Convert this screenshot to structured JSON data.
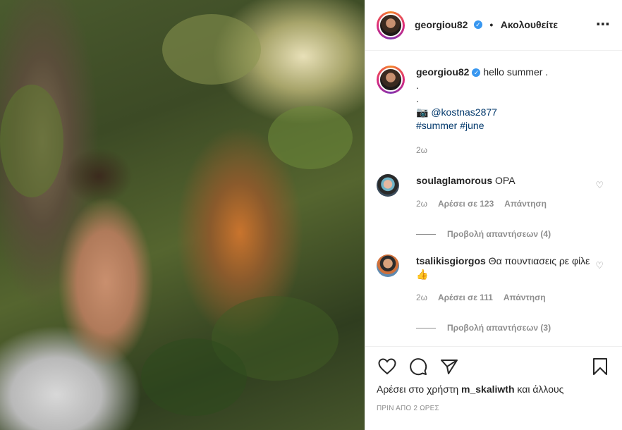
{
  "header": {
    "username": "georgiou82",
    "verified_mark": "✓",
    "separator": "•",
    "follow_label": "Ακολουθείτε",
    "more_icon": "⋯"
  },
  "caption": {
    "username": "georgiou82",
    "text": "hello summer .",
    "dot1": ".",
    "dot2": ".",
    "camera_icon": "📷",
    "mention": "@kostnas2877",
    "hashtag1": "#summer",
    "hashtag2": "#june",
    "time": "2ω"
  },
  "comments": [
    {
      "username": "soulaglamorous",
      "text": "ΟΡΑ",
      "time": "2ω",
      "likes": "Αρέσει σε 123",
      "reply": "Απάντηση",
      "view_replies": "Προβολή απαντήσεων (4)"
    },
    {
      "username": "tsalikisgiorgos",
      "text": "Θα πουντιασεις ρε φίλε 👍",
      "time": "2ω",
      "likes": "Αρέσει σε 111",
      "reply": "Απάντηση",
      "view_replies": "Προβολή απαντήσεων (3)"
    }
  ],
  "footer": {
    "likes_prefix": "Αρέσει στο χρήστη",
    "likes_user": "m_skaliwth",
    "likes_suffix": "και άλλους",
    "timestamp": "ΠΡΙΝ ΑΠΟ 2 ΩΡΕΣ"
  },
  "icons": {
    "heart": "heart-icon",
    "comment": "comment-icon",
    "share": "share-icon",
    "bookmark": "bookmark-icon"
  },
  "colors": {
    "verified": "#3897f0",
    "link": "#00376b",
    "muted": "#8e8e8e",
    "text": "#262626"
  }
}
